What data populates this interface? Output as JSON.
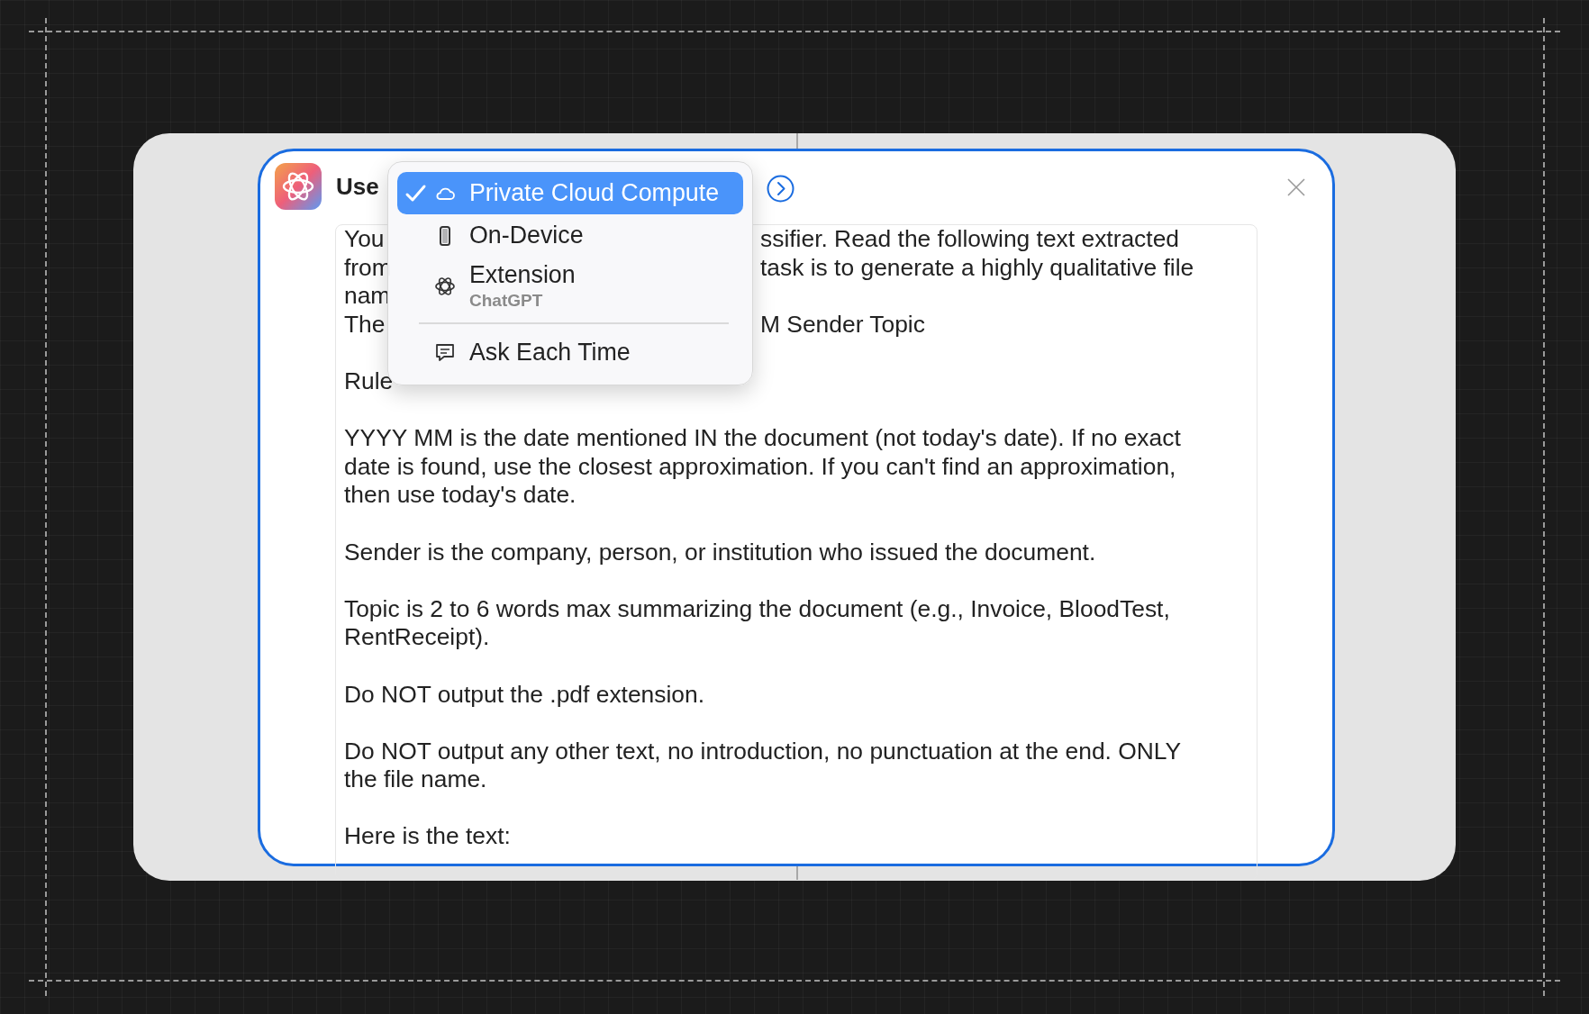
{
  "header": {
    "label": "Use"
  },
  "model_menu": {
    "items": [
      {
        "label": "Private Cloud Compute",
        "selected": true,
        "divider_before": false
      },
      {
        "label": "On-Device",
        "selected": false,
        "divider_before": false
      },
      {
        "label": "Extension",
        "sublabel": "ChatGPT",
        "selected": false,
        "divider_before": false
      },
      {
        "label": "Ask Each Time",
        "selected": false,
        "divider_before": true
      }
    ]
  },
  "prompt": {
    "paragraphs": [
      {
        "lines": [
          {
            "left": "You",
            "right": "ssifier. Read the following text extracted"
          },
          {
            "left": "from",
            "right": "task is to generate a highly qualitative file"
          },
          {
            "left": "nam"
          },
          {
            "left": "The",
            "right": "M Sender Topic"
          }
        ]
      },
      {
        "lines": [
          {
            "left": "Rule"
          }
        ]
      },
      {
        "lines": [
          {
            "left": "YYYY MM is the date mentioned IN the document (not today's date). If no exact"
          },
          {
            "left": "date is found, use the closest approximation. If you can't find an approximation,"
          },
          {
            "left": "then use today's date."
          }
        ]
      },
      {
        "lines": [
          {
            "left": "Sender is the company, person, or institution who issued the document."
          }
        ]
      },
      {
        "lines": [
          {
            "left": "Topic is 2 to 6 words max summarizing the document (e.g., Invoice, BloodTest,"
          },
          {
            "left": "RentReceipt)."
          }
        ]
      },
      {
        "lines": [
          {
            "left": "Do NOT output the .pdf extension."
          }
        ]
      },
      {
        "lines": [
          {
            "left": "Do NOT output any other text, no introduction, no punctuation at the end. ONLY"
          },
          {
            "left": "the file name."
          }
        ]
      },
      {
        "lines": [
          {
            "left": "Here is the text:"
          }
        ]
      }
    ]
  }
}
